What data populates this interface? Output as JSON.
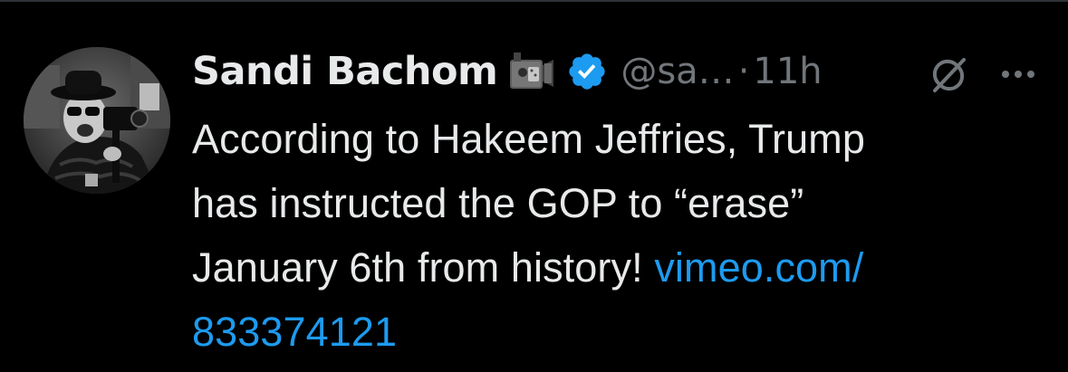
{
  "tweet": {
    "display_name": "Sandi Bachom",
    "handle": "@sa…",
    "separator": "·",
    "time": "11h",
    "body_lines": [
      "According to Hakeem Jeffries, Trump",
      "has instructed the GOP to “erase”"
    ],
    "body_line3_text": "January 6th from history! ",
    "link_part1": "vimeo.com/",
    "link_part2": "833374121"
  },
  "icons": {
    "badge": "camera-emoji-icon",
    "verified": "verified-badge-icon",
    "grok": "grok-icon",
    "more": "more-options-icon"
  },
  "colors": {
    "background": "#000000",
    "text": "#e7e9ea",
    "secondary": "#71767b",
    "link": "#1d9bf0",
    "verified": "#1d9bf0"
  }
}
